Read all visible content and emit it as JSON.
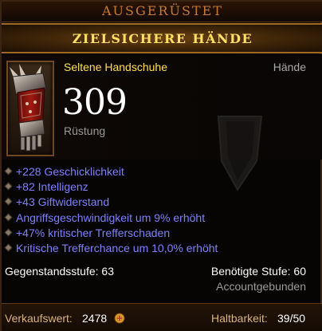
{
  "header": {
    "equipped_label": "AUSGERÜSTET",
    "item_name": "ZIELSICHERE HÄNDE"
  },
  "item": {
    "type_label": "Seltene Handschuhe",
    "slot_label": "Hände",
    "armor_value": "309",
    "armor_label": "Rüstung",
    "icon": "gauntlet-icon"
  },
  "stats": [
    "+228 Geschicklichkeit",
    "+82 Intelligenz",
    "+43 Giftwiderstand",
    "Angriffsgeschwindigkeit um 9% erhöht",
    "+47% kritischer Trefferschaden",
    "Kritische Trefferchance um 10,0% erhöht"
  ],
  "requirements": {
    "item_level": "Gegenstandsstufe: 63",
    "required_level": "Benötigte Stufe: 60",
    "binding": "Accountgebunden"
  },
  "footer": {
    "sell_label": "Verkaufswert:",
    "sell_value": "2478",
    "durability_label": "Haltbarkeit:",
    "durability_value": "39/50"
  },
  "colors": {
    "item_type": "#ffe04a",
    "title": "#ffe066",
    "magic_stat": "#7f7fff",
    "header_text": "#c87a34",
    "footer_label": "#d9b37a"
  }
}
